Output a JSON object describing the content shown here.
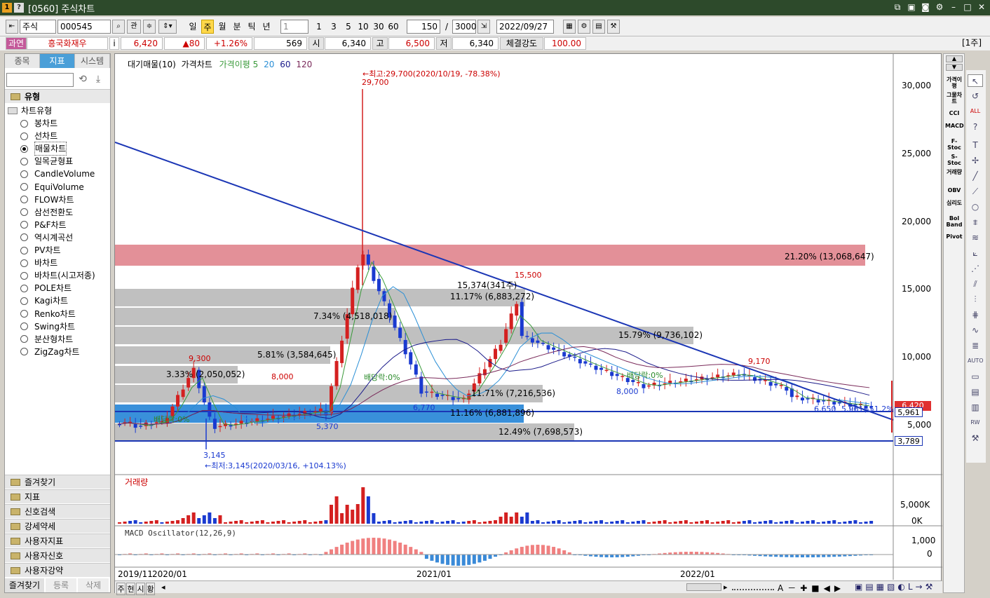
{
  "window": {
    "badge1": "1",
    "badge2": "?",
    "title": "[0560] 주식차트"
  },
  "toolbar": {
    "market": "주식",
    "code": "000545",
    "btn_gwan": "관",
    "periods": [
      "일",
      "주",
      "월",
      "분",
      "틱",
      "년"
    ],
    "period_selected": "주",
    "interval_value": "1",
    "quick_intervals": [
      "1",
      "3",
      "5",
      "10",
      "30",
      "60"
    ],
    "count": "150",
    "max_count": "3000",
    "date": "2022/09/27"
  },
  "quote": {
    "tag": "과연",
    "name": "흥국화재우",
    "info": "i",
    "price": "6,420",
    "change": "▲80",
    "change_pct": "+1.26%",
    "volume": "569",
    "open_label": "시",
    "open": "6,340",
    "high_label": "고",
    "high": "6,500",
    "low_label": "저",
    "low": "6,340",
    "strength_label": "체결강도",
    "strength": "100.00",
    "period_tag": "[1주]"
  },
  "left_panel": {
    "tabs": [
      "종목",
      "지표",
      "시스템"
    ],
    "selected_tab": "지표",
    "section": "유형",
    "subsection": "차트유형",
    "chart_types": [
      "봉차트",
      "선차트",
      "매물차트",
      "일목균형표",
      "CandleVolume",
      "EquiVolume",
      "FLOW차트",
      "삼선전환도",
      "P&F차트",
      "역시계곡선",
      "PV차트",
      "바차트",
      "바차트(시고저종)",
      "POLE차트",
      "Kagi차트",
      "Renko차트",
      "Swing차트",
      "분산형차트",
      "ZigZag차트"
    ],
    "selected_type": "매물차트",
    "folders": [
      "즐겨찾기",
      "지표",
      "신호검색",
      "강세약세",
      "사용자지표",
      "사용자신호",
      "사용자강약"
    ],
    "bottom_tabs": [
      "즐겨찾기",
      "등록",
      "삭제"
    ]
  },
  "chart": {
    "legend": {
      "item1": "대기매물(10)",
      "item2": "가격차트",
      "ma_label": "가격이평",
      "ma": [
        "5",
        "20",
        "60",
        "120"
      ]
    },
    "colors": {
      "ma5": "#3a9a3a",
      "ma20": "#2a8fd6",
      "ma60": "#1a1a8a",
      "ma120": "#7a2a5a",
      "up": "#d42020",
      "down": "#1a3ad0",
      "band": "#bdbdbd",
      "band_hot": "#e28a92",
      "band_blue": "#2e8ad8",
      "trend": "#1b36b5"
    },
    "y_ticks": [
      "30,000",
      "25,000",
      "20,000",
      "15,000",
      "10,000",
      "5,000"
    ],
    "x_ticks": [
      "2019/11",
      "2020/01",
      "2021/01",
      "2022/01"
    ],
    "price_labels": {
      "high": "29,700",
      "hi_note": "←최고:29,700(2020/10/19, -78.38%)",
      "low": "3,145",
      "lo_note": "←최저:3,145(2020/03/16, +104.13%)",
      "p9300": "9,300",
      "p8000": "8,000",
      "p5370": "5,370",
      "p6770": "6,770",
      "p15500": "15,500",
      "p15374": "15,374(341주)",
      "p8000b": "8,000",
      "p9170": "9,170",
      "p6650": "6,650",
      "p5961": "5,961(-51.2%)"
    },
    "dividends": [
      "배당락:0%",
      "배당락:0%",
      "배당락:0%"
    ],
    "axis_marks": {
      "last": "6,420",
      "line1": "5,961",
      "line2": "3,789"
    },
    "bands": [
      "21.20% (13,068,647)",
      "11.17% (6,883,272)",
      "7.34% (4,518,018)",
      "15.79% (9,736,102)",
      "5.81% (3,584,645)",
      "3.33% (2,050,052)",
      "11.71% (7,216,536)",
      "11.16% (6,881,896)",
      "12.49% (7,698,573)"
    ]
  },
  "volume": {
    "title": "거래량",
    "y_ticks": [
      "5,000K",
      "0K"
    ]
  },
  "macd": {
    "title": "MACD Oscillator(12,26,9)",
    "y_ticks": [
      "1,000",
      "0"
    ]
  },
  "bottom": {
    "nav": [
      "주",
      "현",
      "시",
      "황"
    ]
  },
  "right_indicators": [
    "가격이평",
    "그물차트",
    "CCI",
    "MACD",
    "F-Stoc",
    "S-Stoc",
    "거래량",
    "OBV",
    "심리도",
    "Bol Band",
    "Pivot"
  ]
}
